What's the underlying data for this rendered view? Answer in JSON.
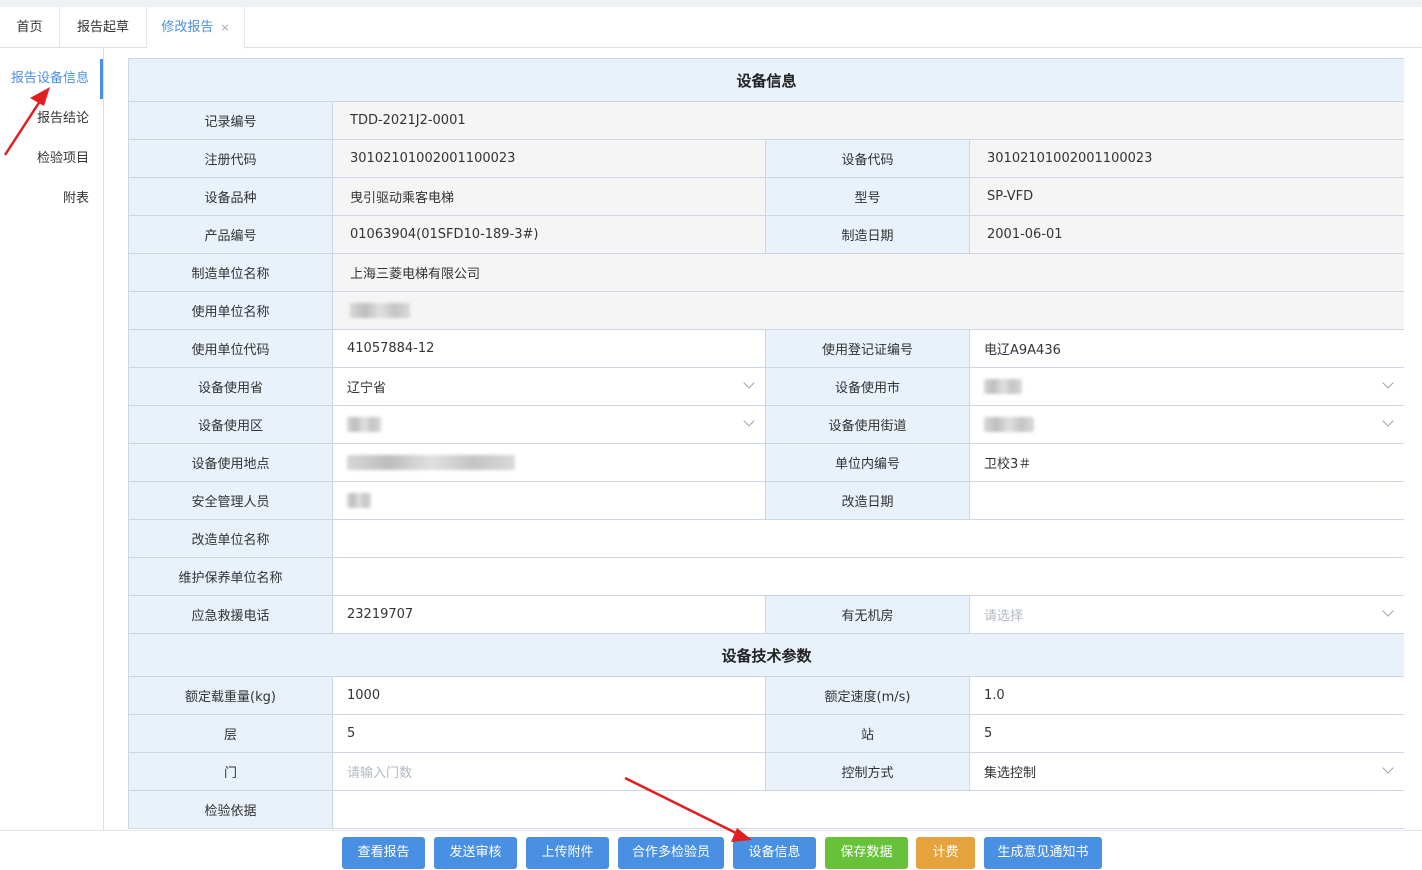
{
  "tabs": [
    {
      "label": "首页"
    },
    {
      "label": "报告起草"
    },
    {
      "label": "修改报告",
      "close": "×"
    }
  ],
  "sidenav": {
    "items": [
      {
        "label": "报告设备信息"
      },
      {
        "label": "报告结论"
      },
      {
        "label": "检验项目"
      },
      {
        "label": "附表"
      }
    ]
  },
  "form": {
    "section_device": "设备信息",
    "section_params": "设备技术参数",
    "record_no": {
      "label": "记录编号",
      "value": "TDD-2021J2-0001"
    },
    "reg_code": {
      "label": "注册代码",
      "value": "30102101002001100023"
    },
    "device_code": {
      "label": "设备代码",
      "value": "30102101002001100023"
    },
    "variety": {
      "label": "设备品种",
      "value": "曳引驱动乘客电梯"
    },
    "model": {
      "label": "型号",
      "value": "SP-VFD"
    },
    "product_no": {
      "label": "产品编号",
      "value": "01063904(01SFD10-189-3#)"
    },
    "mfg_date": {
      "label": "制造日期",
      "value": "2001-06-01"
    },
    "maker": {
      "label": "制造单位名称",
      "value": "上海三菱电梯有限公司"
    },
    "user_unit": {
      "label": "使用单位名称"
    },
    "user_code": {
      "label": "使用单位代码",
      "value": "41057884-12"
    },
    "reg_cert": {
      "label": "使用登记证编号",
      "value": "电辽A9A436"
    },
    "province": {
      "label": "设备使用省",
      "value": "辽宁省"
    },
    "city": {
      "label": "设备使用市"
    },
    "district": {
      "label": "设备使用区"
    },
    "street": {
      "label": "设备使用街道"
    },
    "location": {
      "label": "设备使用地点"
    },
    "internal_no": {
      "label": "单位内编号",
      "value": "卫校3＃"
    },
    "safety_mgr": {
      "label": "安全管理人员"
    },
    "mod_date": {
      "label": "改造日期"
    },
    "mod_unit": {
      "label": "改造单位名称"
    },
    "maint_unit": {
      "label": "维护保养单位名称"
    },
    "emergency_phone": {
      "label": "应急救援电话",
      "value": "23219707"
    },
    "machine_room": {
      "label": "有无机房",
      "placeholder": "请选择"
    },
    "rated_load": {
      "label": "额定载重量(kg)",
      "value": "1000"
    },
    "rated_speed": {
      "label": "额定速度(m/s)",
      "value": "1.0"
    },
    "floors": {
      "label": "层",
      "value": "5"
    },
    "stations": {
      "label": "站",
      "value": "5"
    },
    "doors": {
      "label": "门",
      "placeholder": "请输入门数"
    },
    "control": {
      "label": "控制方式",
      "value": "集选控制"
    },
    "basis": {
      "label": "检验依据"
    }
  },
  "actions": {
    "view_report": "查看报告",
    "send_review": "发送审核",
    "upload": "上传附件",
    "cooperate": "合作多检验员",
    "device_info": "设备信息",
    "save": "保存数据",
    "billing": "计费",
    "notice": "生成意见通知书"
  },
  "colors": {
    "accent": "#4a90e2",
    "button_blue": "#4a90e2",
    "button_green": "#67c23a",
    "button_orange": "#e6a23c",
    "label_bg": "#e9f1fb",
    "annotation_arrow": "#e02020"
  }
}
